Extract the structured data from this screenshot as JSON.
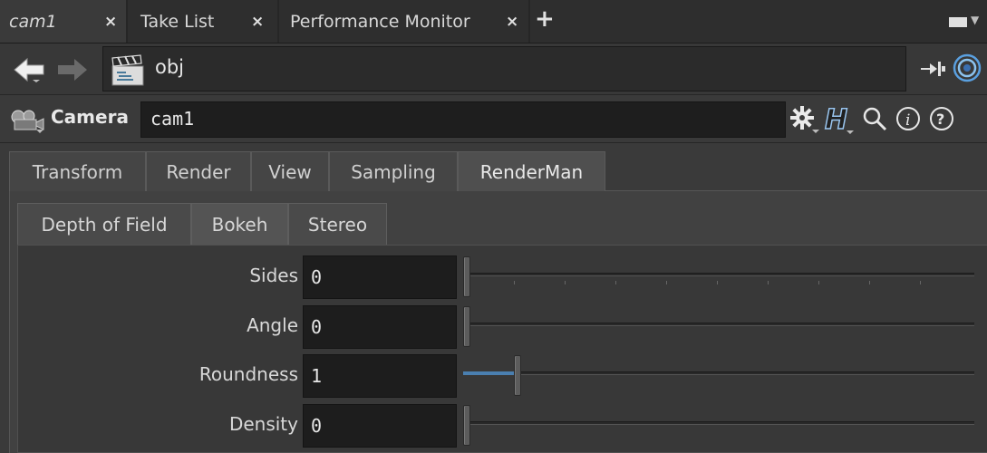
{
  "tabs": [
    {
      "label": "cam1",
      "close": "×"
    },
    {
      "label": "Take List",
      "close": "×"
    },
    {
      "label": "Performance Monitor",
      "close": "×"
    }
  ],
  "new_tab": "+",
  "path": {
    "value": "obj"
  },
  "node": {
    "type": "Camera",
    "name": "cam1"
  },
  "main_tabs": [
    "Transform",
    "Render",
    "View",
    "Sampling",
    "RenderMan"
  ],
  "sub_tabs": [
    "Depth of Field",
    "Bokeh",
    "Stereo"
  ],
  "params": [
    {
      "label": "Sides",
      "value": "0",
      "level": 0
    },
    {
      "label": "Angle",
      "value": "0",
      "level": 0
    },
    {
      "label": "Roundness",
      "value": "1",
      "level": 0.1
    },
    {
      "label": "Density",
      "value": "0",
      "level": 0
    }
  ],
  "colors": {
    "accent": "#4a7fb0",
    "background": "#3a3a3a",
    "field": "#1d1d1d"
  },
  "icons": {
    "back": "arrow-left-icon",
    "forward": "arrow-right-icon",
    "network": "clapperboard-icon",
    "pin": "pin-icon",
    "link": "link-target-icon",
    "gear": "gear-icon",
    "help": "houdini-help-icon",
    "search": "search-icon",
    "info": "info-icon",
    "question": "question-icon"
  }
}
